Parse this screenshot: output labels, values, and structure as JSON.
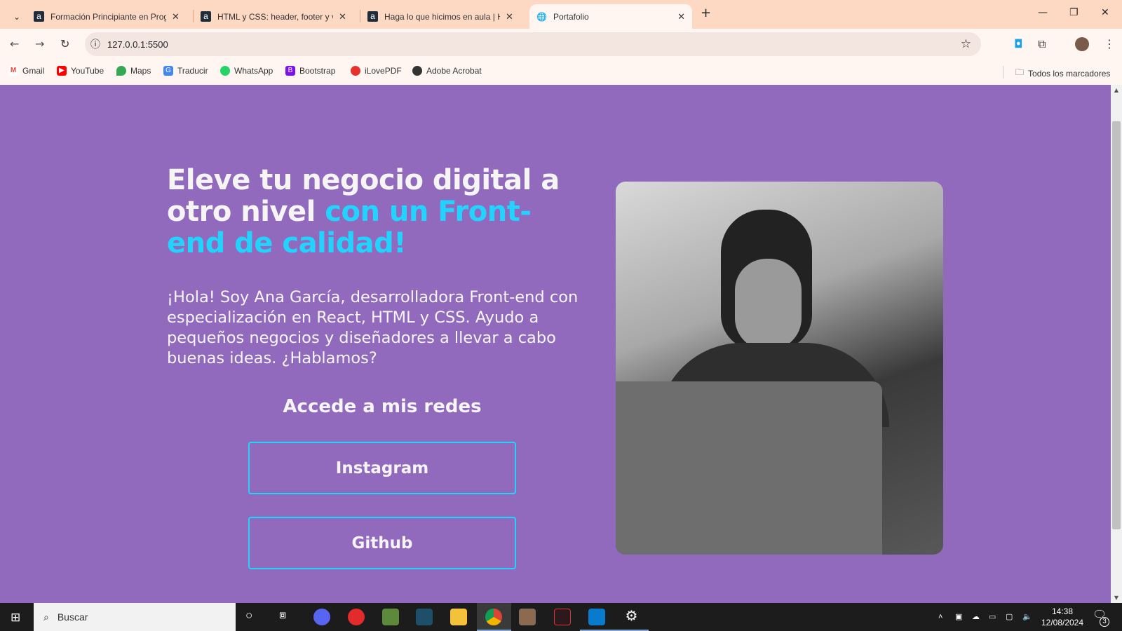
{
  "browser": {
    "tabs": [
      {
        "title": "Formación Principiante en Prog",
        "favicon": "a"
      },
      {
        "title": "HTML y CSS: header, footer y va",
        "favicon": "a"
      },
      {
        "title": "Haga lo que hicimos en aula | H",
        "favicon": "a"
      },
      {
        "title": "Portafolio",
        "favicon": "globe-icon"
      }
    ],
    "url": "127.0.0.1:5500",
    "bookmarks": [
      "Gmail",
      "YouTube",
      "Maps",
      "Traducir",
      "WhatsApp",
      "Bootstrap",
      "iLovePDF",
      "Adobe Acrobat"
    ],
    "all_bookmarks": "Todos los marcadores"
  },
  "page": {
    "title_main": "Eleve tu negocio digital a otro nivel ",
    "title_highlight": "con un Front-end de calidad!",
    "intro": "¡Hola! Soy Ana García, desarrolladora Front-end con especialización en React, HTML y CSS. Ayudo a pequeños negocios y diseñadores a llevar a cabo buenas ideas. ¿Hablamos?",
    "social_heading": "Accede a mis redes",
    "buttons": [
      "Instagram",
      "Github"
    ],
    "colors": {
      "background": "#916ABD",
      "accent": "#22D4FD",
      "text": "#F5F5F5"
    }
  },
  "taskbar": {
    "search_placeholder": "Buscar",
    "time": "14:38",
    "date": "12/08/2024",
    "notifications": "3"
  }
}
